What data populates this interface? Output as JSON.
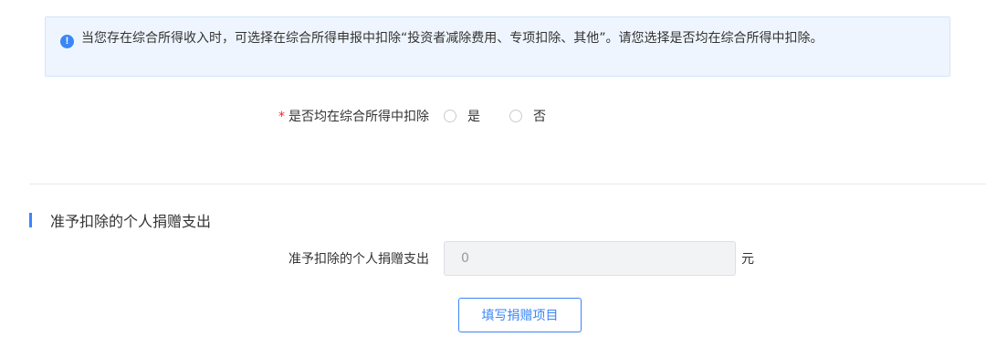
{
  "notice": {
    "icon": "info-icon",
    "icon_glyph": "!",
    "text": "当您存在综合所得收入时，可选择在综合所得申报中扣除“投资者减除费用、专项扣除、其他”。请您选择是否均在综合所得中扣除。"
  },
  "question": {
    "required_mark": "*",
    "label": "是否均在综合所得中扣除",
    "options": [
      {
        "label": "是",
        "selected": false
      },
      {
        "label": "否",
        "selected": false
      }
    ]
  },
  "donation_section": {
    "title": "准予扣除的个人捐赠支出",
    "amount_label": "准予扣除的个人捐赠支出",
    "amount_value": "0",
    "unit": "元",
    "fill_button_label": "填写捐赠项目"
  },
  "colors": {
    "accent": "#3a86f7",
    "notice_bg": "#eef5fe",
    "required": "#f5222d"
  }
}
